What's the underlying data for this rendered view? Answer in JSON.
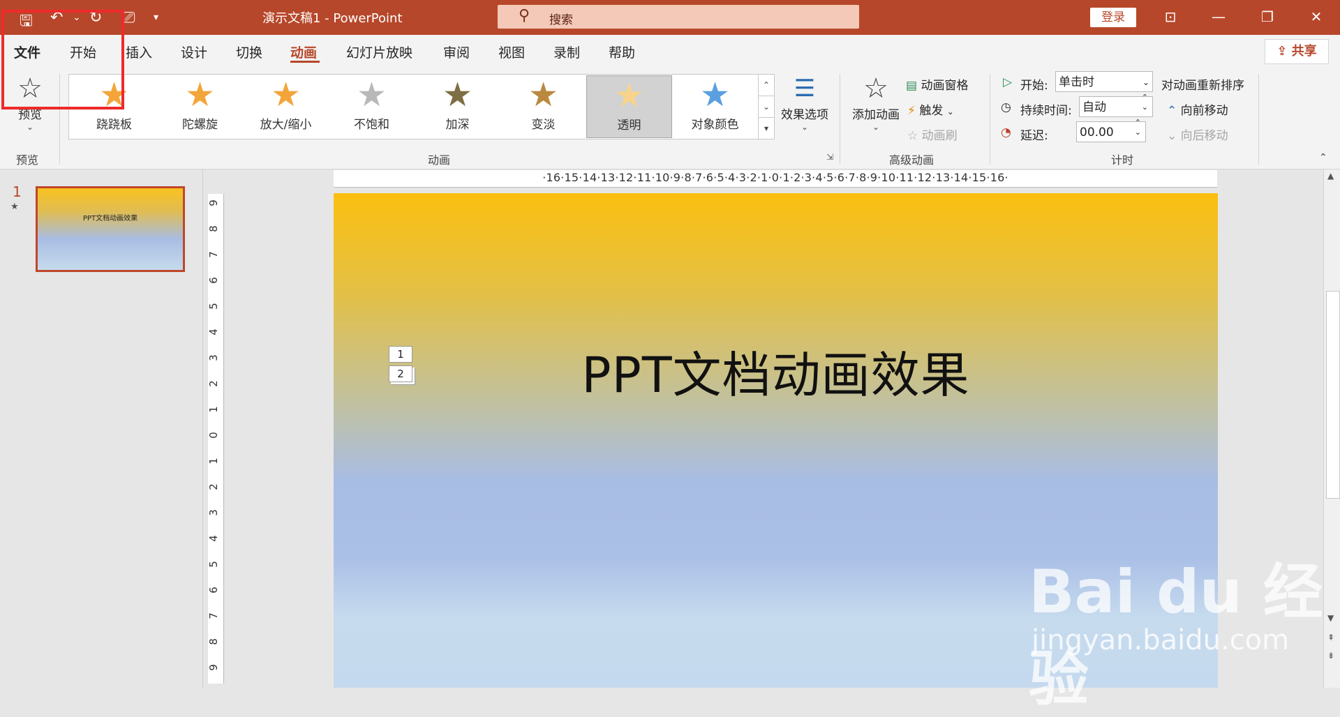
{
  "titlebar": {
    "doc_title": "演示文稿1  -  PowerPoint",
    "search_placeholder": "搜索",
    "login": "登录",
    "qat_icons": [
      "save-icon",
      "undo-icon",
      "redo-icon",
      "present-from-start-icon",
      "customize-qat-icon"
    ]
  },
  "tabs": [
    "文件",
    "开始",
    "插入",
    "设计",
    "切换",
    "动画",
    "幻灯片放映",
    "审阅",
    "视图",
    "录制",
    "帮助"
  ],
  "active_tab": "动画",
  "share": "共享",
  "ribbon": {
    "preview": {
      "button": "预览",
      "group": "预览"
    },
    "animation_group": "动画",
    "gallery": [
      {
        "label": "跷跷板",
        "color": "#f3a53a"
      },
      {
        "label": "陀螺旋",
        "color": "#f3a53a"
      },
      {
        "label": "放大/缩小",
        "color": "#f3a53a"
      },
      {
        "label": "不饱和",
        "color": "#b8b8b8"
      },
      {
        "label": "加深",
        "color": "#8a7a4a"
      },
      {
        "label": "变淡",
        "color": "#c89a4a"
      },
      {
        "label": "透明",
        "color": "#f8d48a",
        "selected": true
      },
      {
        "label": "对象颜色",
        "color": "#5aa0e0"
      }
    ],
    "effect_options": "效果选项",
    "advanced": {
      "group": "高级动画",
      "add_animation": "添加动画",
      "animation_pane": "动画窗格",
      "trigger": "触发",
      "painter": "动画刷"
    },
    "timing": {
      "group": "计时",
      "start_label": "开始:",
      "start_value": "单击时",
      "duration_label": "持续时间:",
      "duration_value": "自动",
      "delay_label": "延迟:",
      "delay_value": "00.00",
      "reorder_title": "对动画重新排序",
      "move_earlier": "向前移动",
      "move_later": "向后移动"
    }
  },
  "thumbnails": [
    {
      "number": "1",
      "text": "PPT文档动画效果"
    }
  ],
  "ruler_h": "·16·15·14·13·12·11·10·9·8·7·6·5·4·3·2·1·0·1·2·3·4·5·6·7·8·9·10·11·12·13·14·15·16·",
  "ruler_v": [
    "9",
    "8",
    "7",
    "6",
    "5",
    "4",
    "3",
    "2",
    "1",
    "0",
    "1",
    "2",
    "3",
    "4",
    "5",
    "6",
    "7",
    "8",
    "9"
  ],
  "slide": {
    "title": "PPT文档动画效果",
    "anim_tags": [
      "1",
      "2"
    ]
  },
  "watermark": {
    "logo": "Bai du 经验",
    "url": "jingyan.baidu.com"
  }
}
